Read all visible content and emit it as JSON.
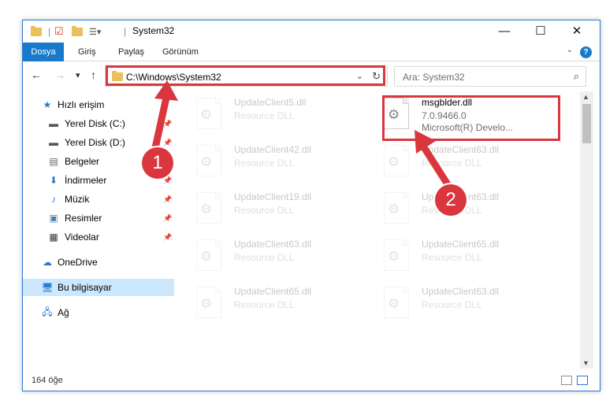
{
  "window": {
    "title": "System32"
  },
  "titlebar": {
    "minimize": "—",
    "maximize": "☐",
    "close": "✕"
  },
  "ribbon": {
    "tabs": [
      "Dosya",
      "Giriş",
      "Paylaş",
      "Görünüm"
    ],
    "help": "?"
  },
  "navbar": {
    "back": "←",
    "forward": "→",
    "recent": "▾",
    "up": "↑",
    "address": "C:\\Windows\\System32",
    "search_placeholder": "Ara: System32"
  },
  "sidebar": {
    "items": [
      {
        "label": "Hızlı erişim",
        "icon": "star-icon"
      },
      {
        "label": "Yerel Disk (C:)",
        "icon": "drive-icon",
        "pinned": true
      },
      {
        "label": "Yerel Disk (D:)",
        "icon": "drive-icon",
        "pinned": true
      },
      {
        "label": "Belgeler",
        "icon": "document-icon",
        "pinned": true
      },
      {
        "label": "İndirmeler",
        "icon": "download-icon",
        "pinned": true
      },
      {
        "label": "Müzik",
        "icon": "music-icon",
        "pinned": true
      },
      {
        "label": "Resimler",
        "icon": "pictures-icon",
        "pinned": true
      },
      {
        "label": "Videolar",
        "icon": "video-icon",
        "pinned": true
      },
      {
        "label": "OneDrive",
        "icon": "cloud-icon"
      },
      {
        "label": "Bu bilgisayar",
        "icon": "computer-icon",
        "selected": true
      },
      {
        "label": "Ağ",
        "icon": "network-icon"
      }
    ]
  },
  "files": [
    {
      "name": "UpdateClient5.dll",
      "type": "Resource DLL"
    },
    {
      "name": "msgblder.dll",
      "version": "7.0.9466.0",
      "company": "Microsoft(R) Develo...",
      "highlighted": true
    },
    {
      "name": "UpdateClient42.dll",
      "type": "Resource DLL"
    },
    {
      "name": "UpdateClient63.dll",
      "type": "Resource DLL"
    },
    {
      "name": "UpdateClient19.dll",
      "type": "Resource DLL"
    },
    {
      "name": "UpdateClient63.dll",
      "type": "Resource DLL"
    },
    {
      "name": "UpdateClient63.dll",
      "type": "Resource DLL"
    },
    {
      "name": "UpdateClient65.dll",
      "type": "Resource DLL"
    },
    {
      "name": "UpdateClient65.dll",
      "type": "Resource DLL"
    },
    {
      "name": "UpdateClient63.dll",
      "type": "Resource DLL"
    }
  ],
  "status": {
    "count": "164 öğe"
  },
  "annotations": {
    "step1": "1",
    "step2": "2"
  },
  "colors": {
    "accent": "#1979ca",
    "highlight": "#d9363e",
    "selected": "#cce8ff"
  }
}
